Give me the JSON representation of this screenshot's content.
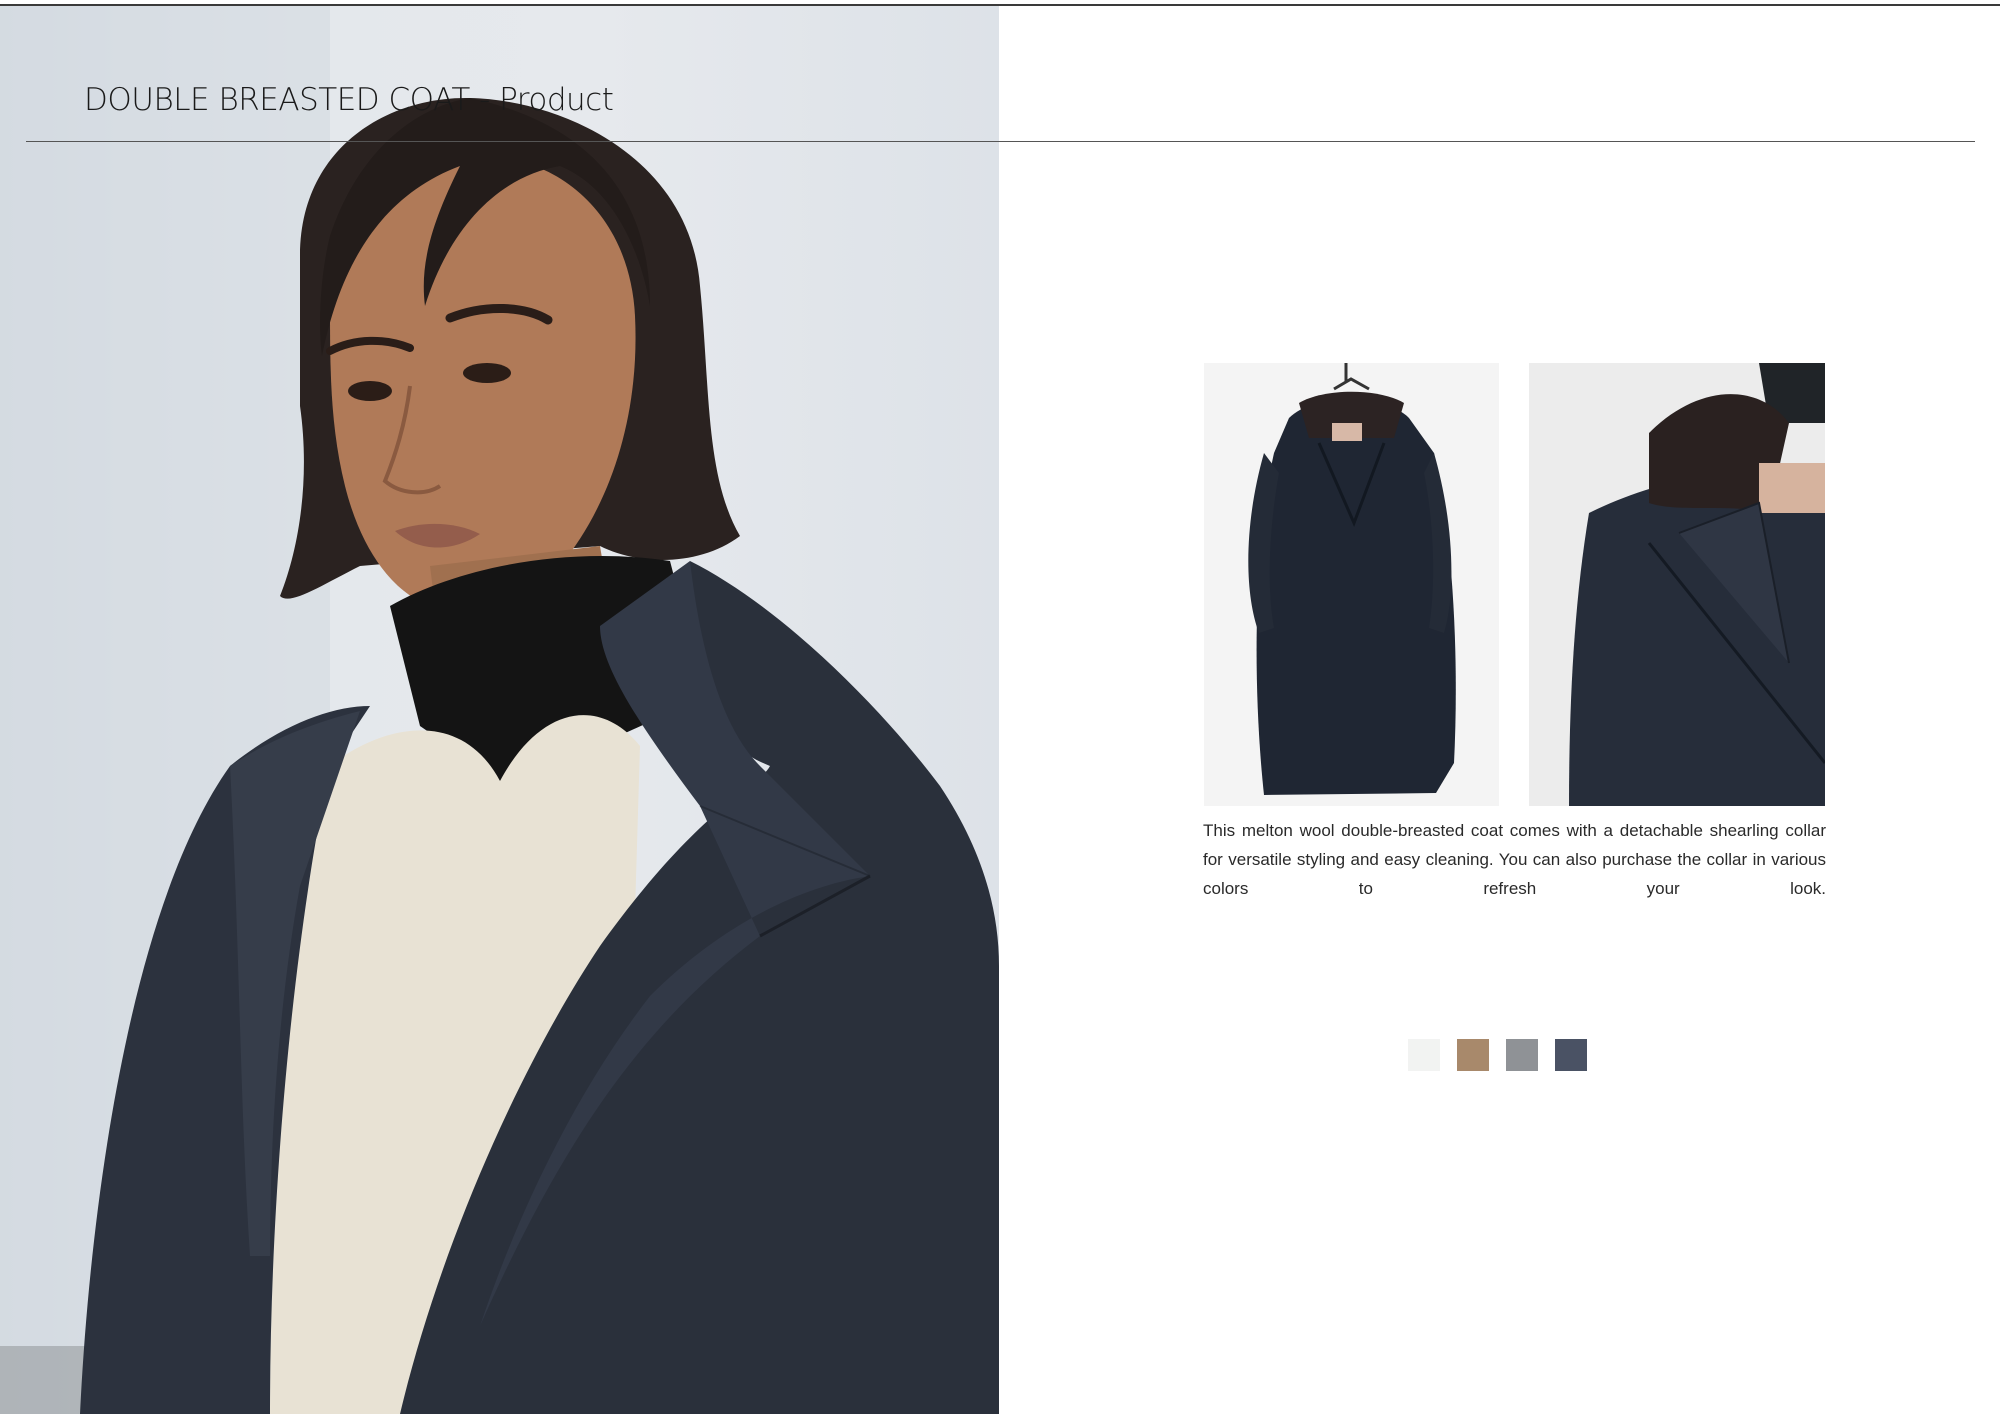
{
  "page": {
    "title": "DOUBLE BREASTED COAT - Product",
    "description": "This melton wool double-breasted coat comes with a detachable shearling collar for versatile styling and easy cleaning. You can also purchase the collar in various colors to refresh your look."
  },
  "images": {
    "hero": "model-wearing-navy-coat-photo",
    "front": "coat-on-hanger-front-photo",
    "detail": "coat-collar-detail-photo"
  },
  "swatches": [
    {
      "name": "white",
      "color": "#f2f3f2"
    },
    {
      "name": "camel",
      "color": "#a8896b"
    },
    {
      "name": "grey",
      "color": "#8f9296"
    },
    {
      "name": "navy",
      "color": "#4a5264"
    }
  ]
}
